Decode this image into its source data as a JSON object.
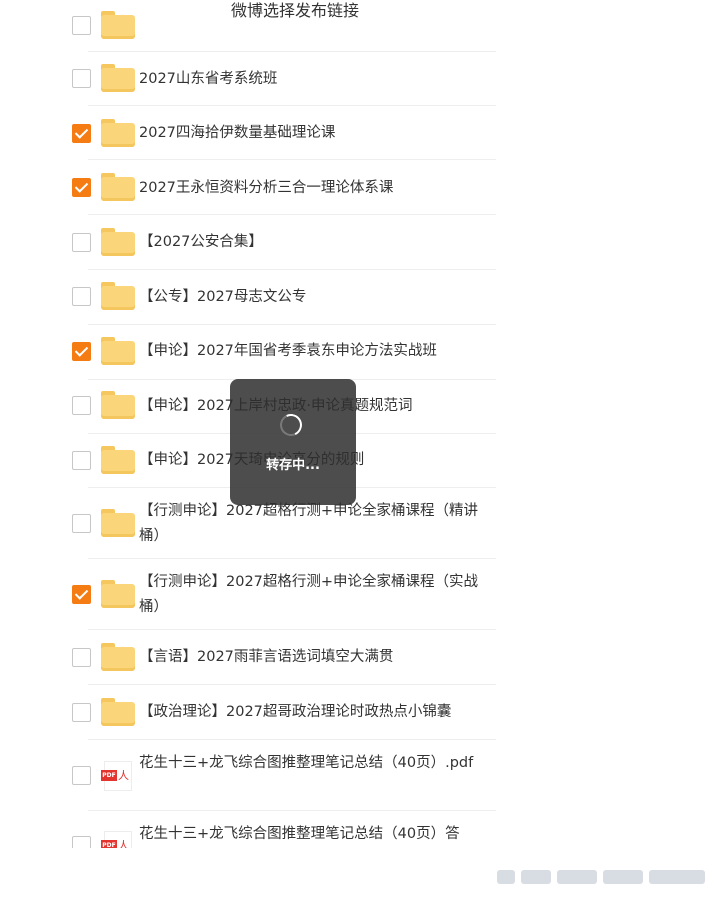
{
  "header": {
    "title": "微博选择发布链接"
  },
  "items": [
    {
      "type": "folder",
      "checked": false,
      "label": ""
    },
    {
      "type": "folder",
      "checked": false,
      "label": "2027山东省考系统班"
    },
    {
      "type": "folder",
      "checked": true,
      "label": "2027四海拾伊数量基础理论课"
    },
    {
      "type": "folder",
      "checked": true,
      "label": "2027王永恒资料分析三合一理论体系课"
    },
    {
      "type": "folder",
      "checked": false,
      "label": "【2027公安合集】"
    },
    {
      "type": "folder",
      "checked": false,
      "label": "【公专】2027母志文公专"
    },
    {
      "type": "folder",
      "checked": true,
      "label": "【申论】2027年国省考季袁东申论方法实战班"
    },
    {
      "type": "folder",
      "checked": false,
      "label": "【申论】2027上岸村忠政·申论真题规范词"
    },
    {
      "type": "folder",
      "checked": false,
      "label": "【申论】2027天琦申论高分的规则"
    },
    {
      "type": "folder",
      "checked": false,
      "label": "【行测申论】2027超格行测+申论全家桶课程（精讲桶）"
    },
    {
      "type": "folder",
      "checked": true,
      "label": "【行测申论】2027超格行测+申论全家桶课程（实战桶）"
    },
    {
      "type": "folder",
      "checked": false,
      "label": "【言语】2027雨菲言语选词填空大满贯"
    },
    {
      "type": "folder",
      "checked": false,
      "label": "【政治理论】2027超哥政治理论时政热点小锦囊"
    },
    {
      "type": "pdf",
      "checked": false,
      "label": "花生十三+龙飞综合图推整理笔记总结（40页）.pdf"
    },
    {
      "type": "pdf",
      "checked": false,
      "label": "花生十三+龙飞综合图推整理笔记总结（40页）答"
    }
  ],
  "overlay": {
    "text": "转存中..."
  },
  "icons": {
    "folder": "folder-icon",
    "pdf": "pdf-file-icon",
    "checkbox": "checkbox-icon",
    "spinner": "loading-spinner-icon"
  },
  "colors": {
    "accent": "#f57c13",
    "folder": "#fbd57a",
    "pdf": "#e3342f"
  }
}
